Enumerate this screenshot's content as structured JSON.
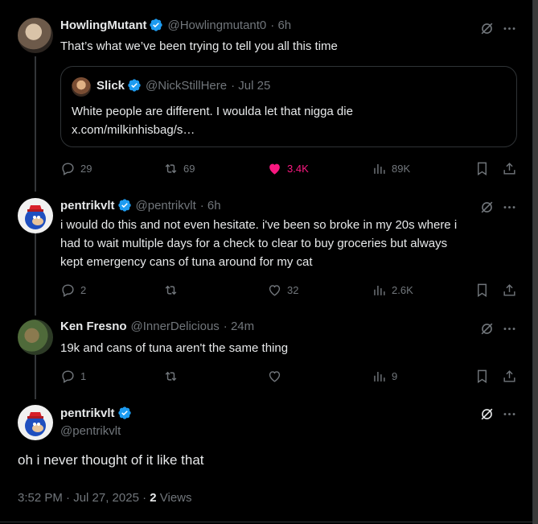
{
  "tweets": [
    {
      "name": "HowlingMutant",
      "handle": "@Howlingmutant0",
      "time": "· 6h",
      "text": "That’s what we’ve been trying to tell you all this time",
      "quote": {
        "name": "Slick",
        "handle": "@NickStillHere",
        "time": "· Jul 25",
        "line1": "White people are different. I woulda let that nigga die",
        "line2": "x.com/milkinhisbag/s…"
      },
      "actions": {
        "replies": "29",
        "reposts": "69",
        "likes": "3.4K",
        "views": "89K"
      }
    },
    {
      "name": "pentrikvlt",
      "handle": "@pentrikvlt",
      "time": "· 6h",
      "text_lines": [
        "i would do this and not even hesitate. i've been so broke in my 20s where i",
        "had to wait multiple days for a check to clear to buy groceries but always",
        "kept emergency cans of tuna around for my cat"
      ],
      "actions": {
        "replies": "2",
        "reposts": "",
        "likes": "32",
        "views": "2.6K"
      }
    },
    {
      "name": "Ken Fresno",
      "handle": "@InnerDelicious",
      "time": "· 24m",
      "text": "19k and cans of tuna aren't the same thing",
      "actions": {
        "replies": "1",
        "reposts": "",
        "likes": "",
        "views": "9"
      }
    }
  ],
  "main_tweet": {
    "name": "pentrikvlt",
    "handle": "@pentrikvlt",
    "text": "oh i never thought of it like that",
    "time": "3:52 PM · Jul 27, 2025 · ",
    "views_count": "2",
    "views_label": " Views"
  },
  "colors": {
    "verified": "#1d9bf0",
    "like": "#f91880",
    "muted": "#71767b"
  },
  "icons": [
    "verified-badge-icon",
    "grok-icon",
    "more-icon",
    "reply-icon",
    "repost-icon",
    "like-icon",
    "views-icon",
    "bookmark-icon",
    "share-icon"
  ]
}
